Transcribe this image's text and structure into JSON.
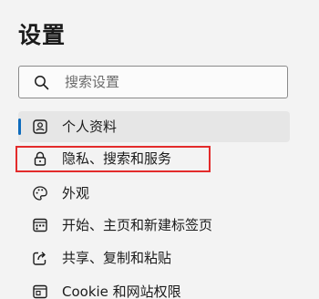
{
  "page": {
    "title": "设置"
  },
  "search": {
    "placeholder": "搜索设置",
    "value": ""
  },
  "nav": {
    "items": [
      {
        "label": "个人资料",
        "icon": "profile-icon",
        "selected": true
      },
      {
        "label": "隐私、搜索和服务",
        "icon": "lock-icon",
        "selected": false,
        "highlighted": true
      },
      {
        "label": "外观",
        "icon": "palette-icon",
        "selected": false
      },
      {
        "label": "开始、主页和新建标签页",
        "icon": "tab-page-icon",
        "selected": false
      },
      {
        "label": "共享、复制和粘贴",
        "icon": "share-icon",
        "selected": false
      },
      {
        "label": "Cookie 和网站权限",
        "icon": "site-permissions-icon",
        "selected": false
      }
    ]
  },
  "colors": {
    "accent": "#0f6cbd",
    "highlight": "#e32b2b",
    "background": "#f3f3f3",
    "selected_bg": "#e6e6e6"
  }
}
